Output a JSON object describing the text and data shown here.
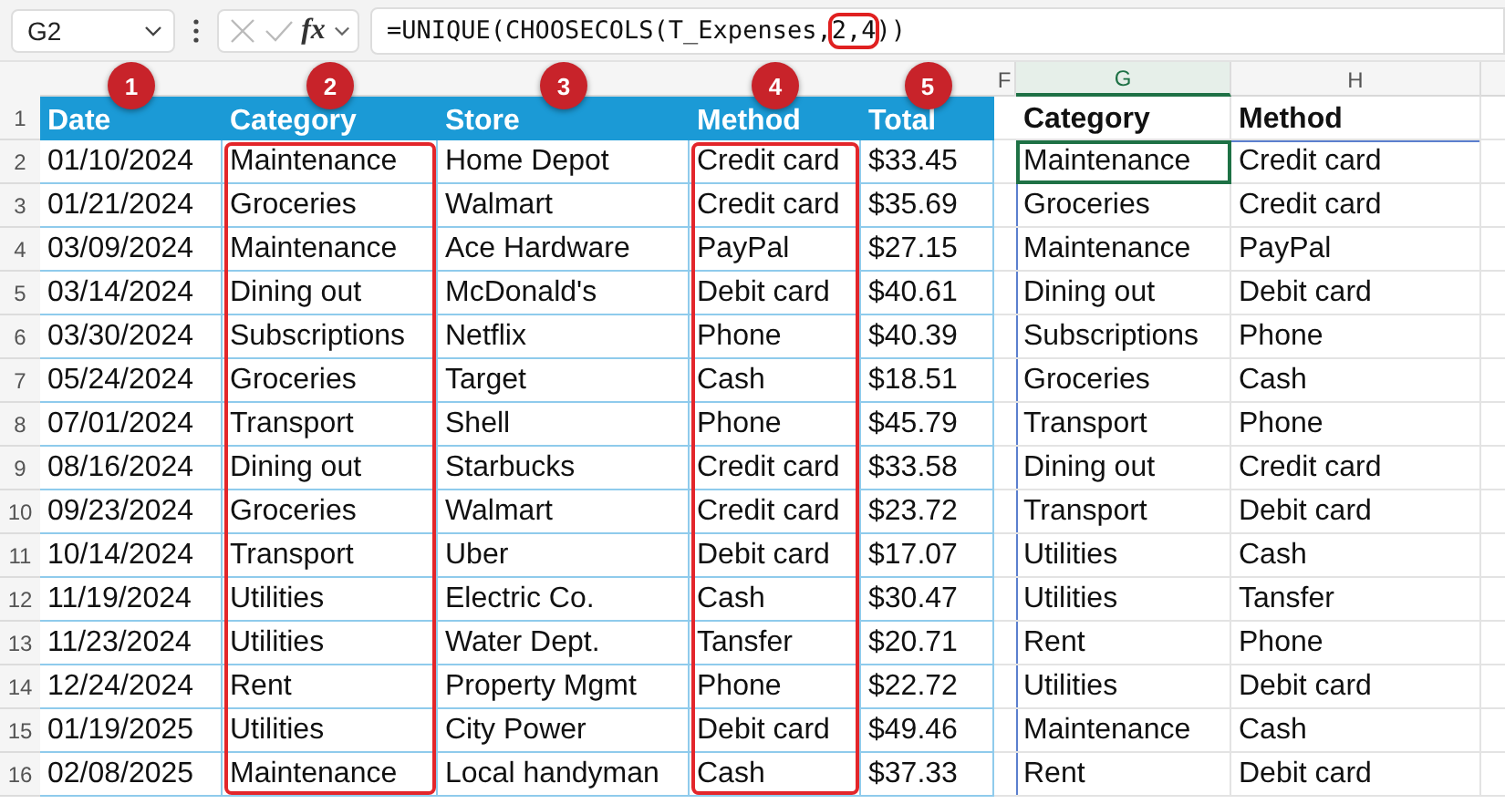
{
  "name_box": "G2",
  "formula_bar": {
    "fx_label": "fx",
    "parts": [
      {
        "text": "=UNIQUE(CHOOSECOLS(T_Expenses,",
        "highlighted": false
      },
      {
        "text": "2,4",
        "highlighted": true
      },
      {
        "text": "))",
        "highlighted": false
      }
    ]
  },
  "column_letters": [
    "F",
    "G",
    "H"
  ],
  "badges": [
    "1",
    "2",
    "3",
    "4",
    "5"
  ],
  "row_numbers": [
    "1",
    "2",
    "3",
    "4",
    "5",
    "6",
    "7",
    "8",
    "9",
    "10",
    "11",
    "12",
    "13",
    "14",
    "15",
    "16"
  ],
  "table": {
    "columns": [
      {
        "name": "Date",
        "highlighted": false
      },
      {
        "name": "Category",
        "highlighted": true
      },
      {
        "name": "Store",
        "highlighted": false
      },
      {
        "name": "Method",
        "highlighted": true
      },
      {
        "name": "Total",
        "highlighted": false
      }
    ],
    "rows": [
      [
        "01/10/2024",
        "Maintenance",
        "Home Depot",
        "Credit card",
        "$33.45"
      ],
      [
        "01/21/2024",
        "Groceries",
        "Walmart",
        "Credit card",
        "$35.69"
      ],
      [
        "03/09/2024",
        "Maintenance",
        "Ace Hardware",
        "PayPal",
        "$27.15"
      ],
      [
        "03/14/2024",
        "Dining out",
        "McDonald's",
        "Debit card",
        "$40.61"
      ],
      [
        "03/30/2024",
        "Subscriptions",
        "Netflix",
        "Phone",
        "$40.39"
      ],
      [
        "05/24/2024",
        "Groceries",
        "Target",
        "Cash",
        "$18.51"
      ],
      [
        "07/01/2024",
        "Transport",
        "Shell",
        "Phone",
        "$45.79"
      ],
      [
        "08/16/2024",
        "Dining out",
        "Starbucks",
        "Credit card",
        "$33.58"
      ],
      [
        "09/23/2024",
        "Groceries",
        "Walmart",
        "Credit card",
        "$23.72"
      ],
      [
        "10/14/2024",
        "Transport",
        "Uber",
        "Debit card",
        "$17.07"
      ],
      [
        "11/19/2024",
        "Utilities",
        "Electric Co.",
        "Cash",
        "$30.47"
      ],
      [
        "11/23/2024",
        "Utilities",
        "Water Dept.",
        "Tansfer",
        "$20.71"
      ],
      [
        "12/24/2024",
        "Rent",
        "Property Mgmt",
        "Phone",
        "$22.72"
      ],
      [
        "01/19/2025",
        "Utilities",
        "City Power",
        "Debit card",
        "$49.46"
      ],
      [
        "02/08/2025",
        "Maintenance",
        "Local handyman",
        "Cash",
        "$37.33"
      ]
    ]
  },
  "result": {
    "headers": [
      "Category",
      "Method"
    ],
    "rows": [
      {
        "cells": [
          "Maintenance",
          "Credit card"
        ],
        "selected": true
      },
      {
        "cells": [
          "Groceries",
          "Credit card"
        ],
        "selected": false
      },
      {
        "cells": [
          "Maintenance",
          "PayPal"
        ],
        "selected": false
      },
      {
        "cells": [
          "Dining out",
          "Debit card"
        ],
        "selected": false
      },
      {
        "cells": [
          "Subscriptions",
          "Phone"
        ],
        "selected": false
      },
      {
        "cells": [
          "Groceries",
          "Cash"
        ],
        "selected": false
      },
      {
        "cells": [
          "Transport",
          "Phone"
        ],
        "selected": false
      },
      {
        "cells": [
          "Dining out",
          "Credit card"
        ],
        "selected": false
      },
      {
        "cells": [
          "Transport",
          "Debit card"
        ],
        "selected": false
      },
      {
        "cells": [
          "Utilities",
          "Cash"
        ],
        "selected": false
      },
      {
        "cells": [
          "Utilities",
          "Tansfer"
        ],
        "selected": false
      },
      {
        "cells": [
          "Rent",
          "Phone"
        ],
        "selected": false
      },
      {
        "cells": [
          "Utilities",
          "Debit card"
        ],
        "selected": false
      },
      {
        "cells": [
          "Maintenance",
          "Cash"
        ],
        "selected": false
      },
      {
        "cells": [
          "Rent",
          "Debit card"
        ],
        "selected": false
      }
    ]
  }
}
